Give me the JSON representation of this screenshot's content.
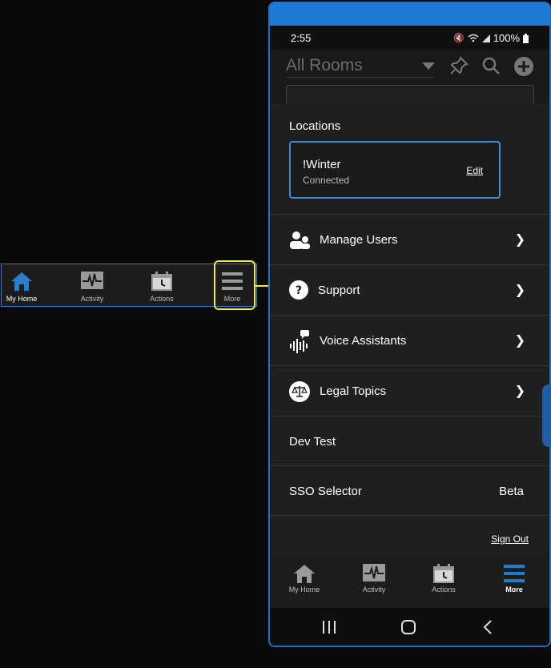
{
  "status_bar": {
    "time": "2:55",
    "battery": "100%"
  },
  "header": {
    "room_select": "All Rooms"
  },
  "locations": {
    "title": "Locations",
    "card": {
      "name": "!Winter",
      "status": "Connected",
      "edit_label": "Edit"
    }
  },
  "menu": {
    "items": [
      {
        "label": "Manage Users",
        "icon": "users-icon"
      },
      {
        "label": "Support",
        "icon": "question-icon"
      },
      {
        "label": "Voice Assistants",
        "icon": "voice-icon"
      },
      {
        "label": "Legal Topics",
        "icon": "scales-icon"
      },
      {
        "label": "Dev Test"
      },
      {
        "label": "SSO Selector",
        "value": "Beta"
      }
    ],
    "sign_out": "Sign Out"
  },
  "tabs": [
    {
      "label": "My Home",
      "icon": "home-icon"
    },
    {
      "label": "Activity",
      "icon": "activity-icon"
    },
    {
      "label": "Actions",
      "icon": "calendar-icon"
    },
    {
      "label": "More",
      "icon": "menu-icon",
      "active": true
    }
  ],
  "mini_tabs": [
    {
      "label": "My Home",
      "icon": "home-icon",
      "active": true
    },
    {
      "label": "Activity",
      "icon": "activity-icon"
    },
    {
      "label": "Actions",
      "icon": "calendar-icon"
    },
    {
      "label": "More",
      "icon": "menu-icon"
    }
  ],
  "colors": {
    "accent": "#1e6fc9",
    "highlight": "#f2ea2c",
    "home_active": "#2a7fc9"
  }
}
